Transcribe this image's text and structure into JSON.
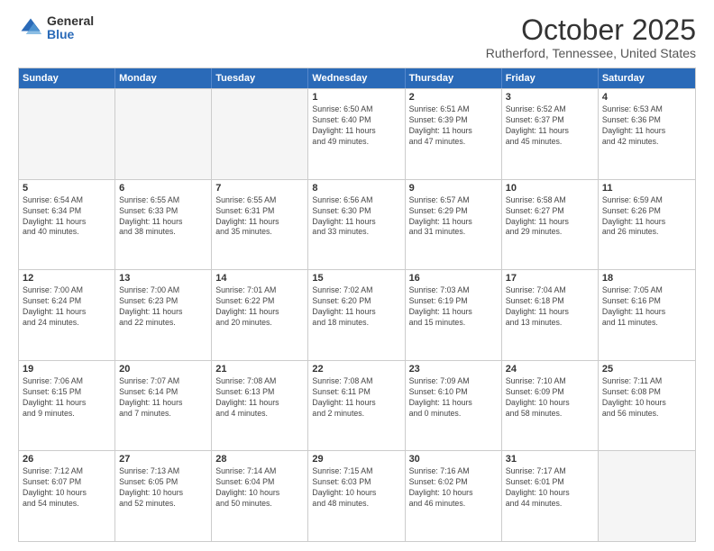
{
  "logo": {
    "general": "General",
    "blue": "Blue"
  },
  "title": "October 2025",
  "location": "Rutherford, Tennessee, United States",
  "days_of_week": [
    "Sunday",
    "Monday",
    "Tuesday",
    "Wednesday",
    "Thursday",
    "Friday",
    "Saturday"
  ],
  "weeks": [
    [
      {
        "day": "",
        "info": ""
      },
      {
        "day": "",
        "info": ""
      },
      {
        "day": "",
        "info": ""
      },
      {
        "day": "1",
        "info": "Sunrise: 6:50 AM\nSunset: 6:40 PM\nDaylight: 11 hours\nand 49 minutes."
      },
      {
        "day": "2",
        "info": "Sunrise: 6:51 AM\nSunset: 6:39 PM\nDaylight: 11 hours\nand 47 minutes."
      },
      {
        "day": "3",
        "info": "Sunrise: 6:52 AM\nSunset: 6:37 PM\nDaylight: 11 hours\nand 45 minutes."
      },
      {
        "day": "4",
        "info": "Sunrise: 6:53 AM\nSunset: 6:36 PM\nDaylight: 11 hours\nand 42 minutes."
      }
    ],
    [
      {
        "day": "5",
        "info": "Sunrise: 6:54 AM\nSunset: 6:34 PM\nDaylight: 11 hours\nand 40 minutes."
      },
      {
        "day": "6",
        "info": "Sunrise: 6:55 AM\nSunset: 6:33 PM\nDaylight: 11 hours\nand 38 minutes."
      },
      {
        "day": "7",
        "info": "Sunrise: 6:55 AM\nSunset: 6:31 PM\nDaylight: 11 hours\nand 35 minutes."
      },
      {
        "day": "8",
        "info": "Sunrise: 6:56 AM\nSunset: 6:30 PM\nDaylight: 11 hours\nand 33 minutes."
      },
      {
        "day": "9",
        "info": "Sunrise: 6:57 AM\nSunset: 6:29 PM\nDaylight: 11 hours\nand 31 minutes."
      },
      {
        "day": "10",
        "info": "Sunrise: 6:58 AM\nSunset: 6:27 PM\nDaylight: 11 hours\nand 29 minutes."
      },
      {
        "day": "11",
        "info": "Sunrise: 6:59 AM\nSunset: 6:26 PM\nDaylight: 11 hours\nand 26 minutes."
      }
    ],
    [
      {
        "day": "12",
        "info": "Sunrise: 7:00 AM\nSunset: 6:24 PM\nDaylight: 11 hours\nand 24 minutes."
      },
      {
        "day": "13",
        "info": "Sunrise: 7:00 AM\nSunset: 6:23 PM\nDaylight: 11 hours\nand 22 minutes."
      },
      {
        "day": "14",
        "info": "Sunrise: 7:01 AM\nSunset: 6:22 PM\nDaylight: 11 hours\nand 20 minutes."
      },
      {
        "day": "15",
        "info": "Sunrise: 7:02 AM\nSunset: 6:20 PM\nDaylight: 11 hours\nand 18 minutes."
      },
      {
        "day": "16",
        "info": "Sunrise: 7:03 AM\nSunset: 6:19 PM\nDaylight: 11 hours\nand 15 minutes."
      },
      {
        "day": "17",
        "info": "Sunrise: 7:04 AM\nSunset: 6:18 PM\nDaylight: 11 hours\nand 13 minutes."
      },
      {
        "day": "18",
        "info": "Sunrise: 7:05 AM\nSunset: 6:16 PM\nDaylight: 11 hours\nand 11 minutes."
      }
    ],
    [
      {
        "day": "19",
        "info": "Sunrise: 7:06 AM\nSunset: 6:15 PM\nDaylight: 11 hours\nand 9 minutes."
      },
      {
        "day": "20",
        "info": "Sunrise: 7:07 AM\nSunset: 6:14 PM\nDaylight: 11 hours\nand 7 minutes."
      },
      {
        "day": "21",
        "info": "Sunrise: 7:08 AM\nSunset: 6:13 PM\nDaylight: 11 hours\nand 4 minutes."
      },
      {
        "day": "22",
        "info": "Sunrise: 7:08 AM\nSunset: 6:11 PM\nDaylight: 11 hours\nand 2 minutes."
      },
      {
        "day": "23",
        "info": "Sunrise: 7:09 AM\nSunset: 6:10 PM\nDaylight: 11 hours\nand 0 minutes."
      },
      {
        "day": "24",
        "info": "Sunrise: 7:10 AM\nSunset: 6:09 PM\nDaylight: 10 hours\nand 58 minutes."
      },
      {
        "day": "25",
        "info": "Sunrise: 7:11 AM\nSunset: 6:08 PM\nDaylight: 10 hours\nand 56 minutes."
      }
    ],
    [
      {
        "day": "26",
        "info": "Sunrise: 7:12 AM\nSunset: 6:07 PM\nDaylight: 10 hours\nand 54 minutes."
      },
      {
        "day": "27",
        "info": "Sunrise: 7:13 AM\nSunset: 6:05 PM\nDaylight: 10 hours\nand 52 minutes."
      },
      {
        "day": "28",
        "info": "Sunrise: 7:14 AM\nSunset: 6:04 PM\nDaylight: 10 hours\nand 50 minutes."
      },
      {
        "day": "29",
        "info": "Sunrise: 7:15 AM\nSunset: 6:03 PM\nDaylight: 10 hours\nand 48 minutes."
      },
      {
        "day": "30",
        "info": "Sunrise: 7:16 AM\nSunset: 6:02 PM\nDaylight: 10 hours\nand 46 minutes."
      },
      {
        "day": "31",
        "info": "Sunrise: 7:17 AM\nSunset: 6:01 PM\nDaylight: 10 hours\nand 44 minutes."
      },
      {
        "day": "",
        "info": ""
      }
    ]
  ]
}
